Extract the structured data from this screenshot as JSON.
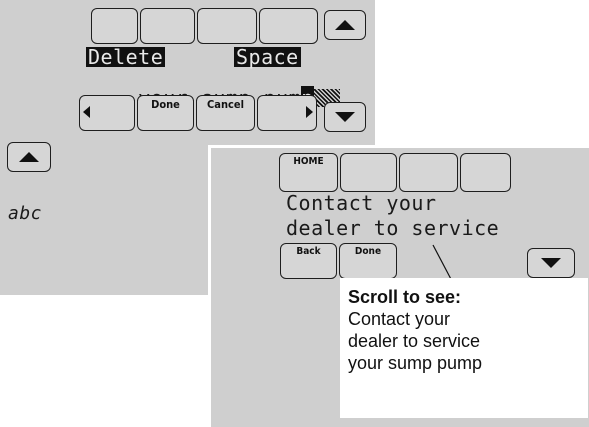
{
  "screen1": {
    "title_buttons": [
      "",
      "",
      "",
      ""
    ],
    "delete_label": "Delete",
    "space_label": "Space",
    "entry_text": "your sump pum",
    "cursor_char": "p",
    "done_label": "Done",
    "cancel_label": "Cancel",
    "char_set": "abc"
  },
  "screen2": {
    "home_label": "HOME",
    "message_line1": "Contact your",
    "message_line2": "dealer to service",
    "back_label": "Back",
    "done_label": "Done"
  },
  "callout": {
    "heading": "Scroll to see:",
    "line1": "Contact your",
    "line2": "dealer to service",
    "line3": "your sump pump"
  }
}
